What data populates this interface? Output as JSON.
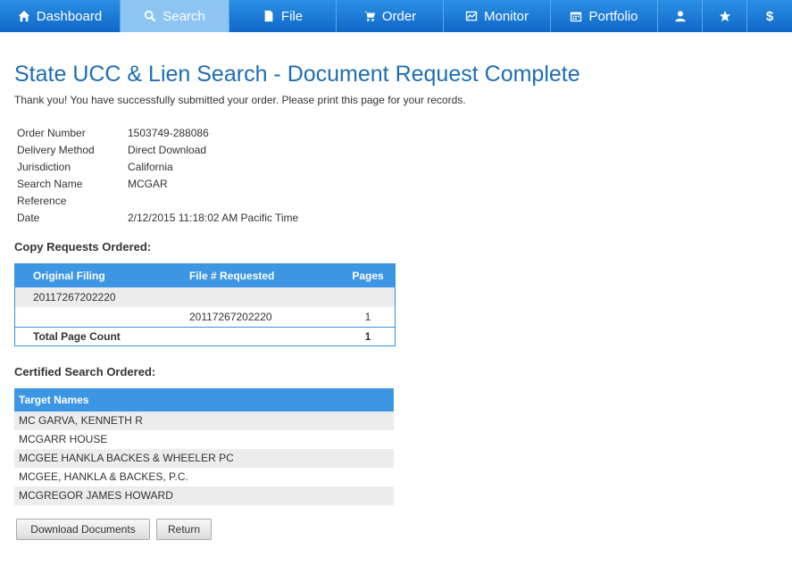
{
  "nav": {
    "items": [
      {
        "label": "Dashboard",
        "icon": "home-icon"
      },
      {
        "label": "Search",
        "icon": "search-icon",
        "active": true
      },
      {
        "label": "File",
        "icon": "file-icon"
      },
      {
        "label": "Order",
        "icon": "cart-icon"
      },
      {
        "label": "Monitor",
        "icon": "chart-icon"
      },
      {
        "label": "Portfolio",
        "icon": "calendar-icon"
      },
      {
        "label": "",
        "icon": "user-icon"
      },
      {
        "label": "",
        "icon": "star-icon"
      },
      {
        "label": "",
        "icon": "dollar-icon"
      }
    ]
  },
  "page": {
    "title": "State UCC & Lien Search - Document Request Complete",
    "subtitle": "Thank you! You have successfully submitted your order. Please print this page for your records."
  },
  "details": [
    {
      "label": "Order Number",
      "value": "1503749-288086"
    },
    {
      "label": "Delivery Method",
      "value": "Direct Download"
    },
    {
      "label": "Jurisdiction",
      "value": "California"
    },
    {
      "label": "Search Name",
      "value": "MCGAR"
    },
    {
      "label": "Reference",
      "value": ""
    },
    {
      "label": "Date",
      "value": "2/12/2015 11:18:02 AM Pacific Time"
    }
  ],
  "copy_requests": {
    "title": "Copy Requests Ordered:",
    "headers": [
      "Original Filing",
      "File # Requested",
      "Pages"
    ],
    "rows": [
      [
        "20117267202220",
        "",
        ""
      ],
      [
        "",
        "20117267202220",
        "1"
      ]
    ],
    "total_label": "Total Page Count",
    "total_value": "1"
  },
  "certified": {
    "title": "Certified Search Ordered:",
    "header": "Target Names",
    "names": [
      "MC GARVA, KENNETH R",
      "MCGARR HOUSE",
      "MCGEE HANKLA BACKES & WHEELER PC",
      "MCGEE, HANKLA & BACKES, P.C.",
      "MCGREGOR JAMES HOWARD"
    ]
  },
  "buttons": {
    "download": "Download Documents",
    "return": "Return"
  },
  "colors": {
    "nav": "#1f80d9",
    "nav_active": "#8cc4f2",
    "title": "#1d6db5",
    "table_header": "#3d96e4",
    "row_shade": "#ececec"
  }
}
